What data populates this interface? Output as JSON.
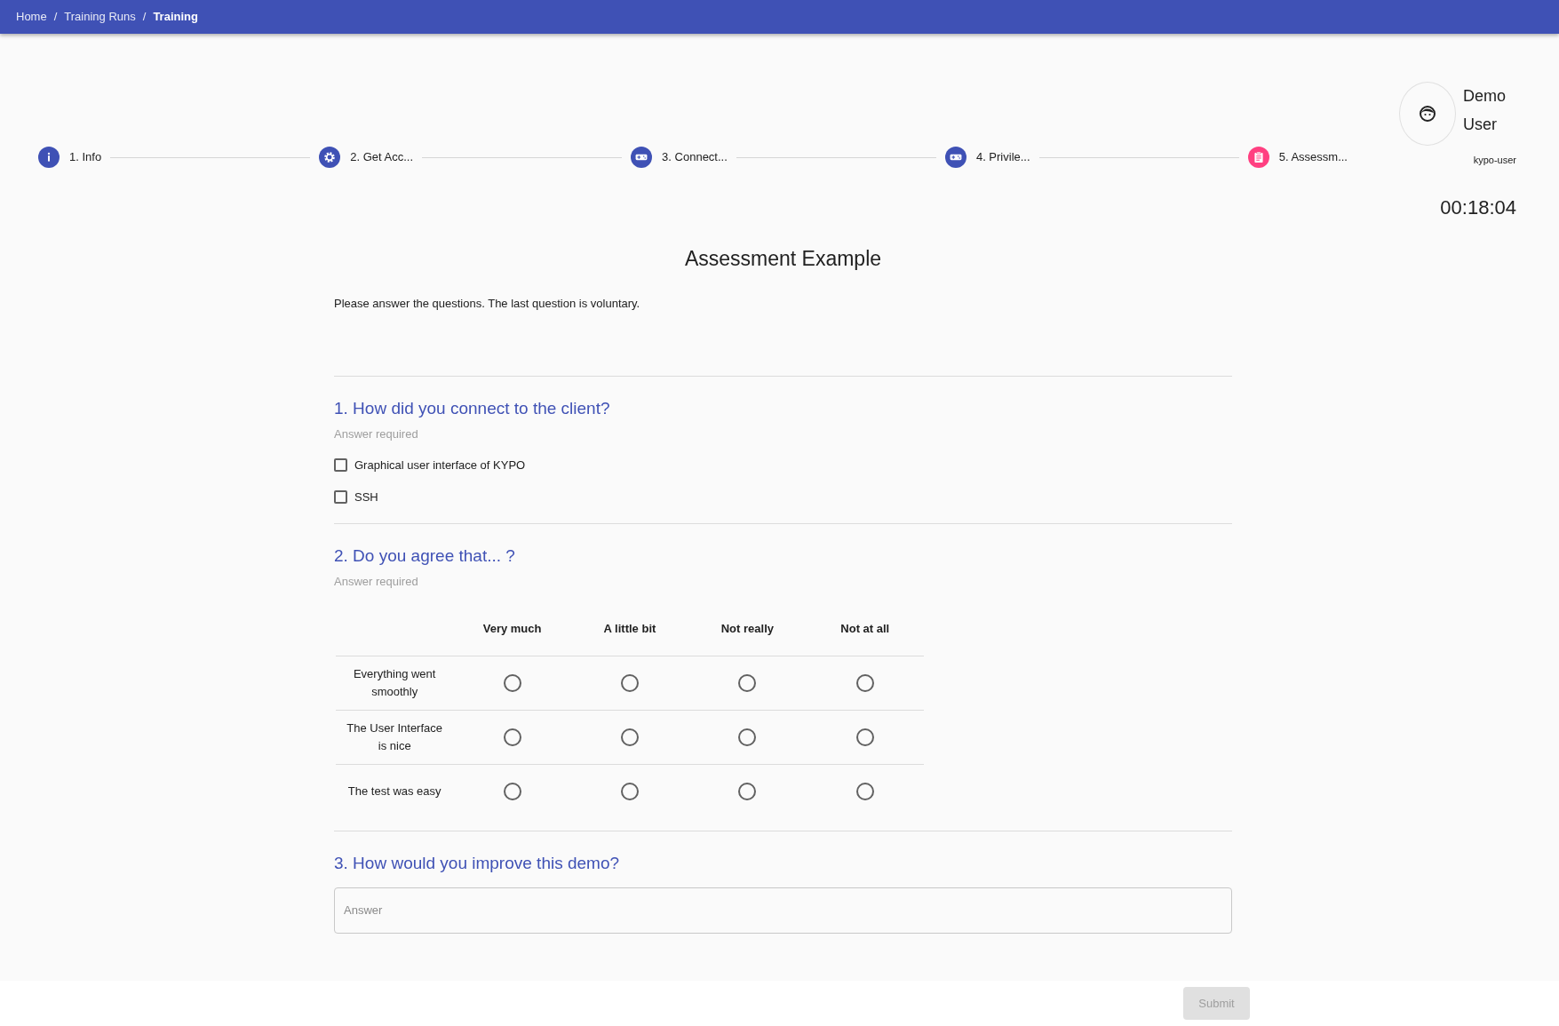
{
  "breadcrumb": [
    {
      "label": "Home",
      "current": false
    },
    {
      "separator": "/",
      "label": "Training Runs",
      "current": false
    },
    {
      "separator": "/",
      "label": "Training",
      "current": true
    }
  ],
  "steps": [
    {
      "label": "1. Info",
      "kind": "info",
      "selected": false
    },
    {
      "label": "2. Get Acc...",
      "kind": "gear",
      "selected": false
    },
    {
      "label": "3. Connect...",
      "kind": "gamepad",
      "selected": false
    },
    {
      "label": "4. Privile...",
      "kind": "gamepad",
      "selected": false
    },
    {
      "label": "5. Assessm...",
      "kind": "clipboard",
      "selected": true
    }
  ],
  "user": {
    "name": "Demo User",
    "login": "kypo-user"
  },
  "timer": "00:18:04",
  "title": "Assessment Example",
  "description": "Please answer the questions. The last question is voluntary.",
  "questions": [
    {
      "kind": "multiple_choice",
      "title": "1. How did you connect to the client?",
      "note": "Answer required",
      "options": [
        {
          "label": "Graphical user interface of KYPO",
          "checked": false
        },
        {
          "label": "SSH",
          "checked": false
        }
      ]
    },
    {
      "kind": "matrix",
      "title": "2. Do you agree that... ?",
      "note": "Answer required",
      "columns": [
        "Very much",
        "A little bit",
        "Not really",
        "Not at all"
      ],
      "rows": [
        {
          "label": "Everything went smoothly",
          "selected": [
            false,
            false,
            false,
            false
          ]
        },
        {
          "label": "The User Interface is nice",
          "selected": [
            false,
            false,
            false,
            false
          ]
        },
        {
          "label": "The test was easy",
          "selected": [
            false,
            false,
            false,
            false
          ]
        }
      ]
    },
    {
      "kind": "free_form",
      "title": "3. How would you improve this demo?",
      "placeholder": "Answer"
    }
  ],
  "submit": {
    "label": "Submit",
    "disabled": true
  }
}
